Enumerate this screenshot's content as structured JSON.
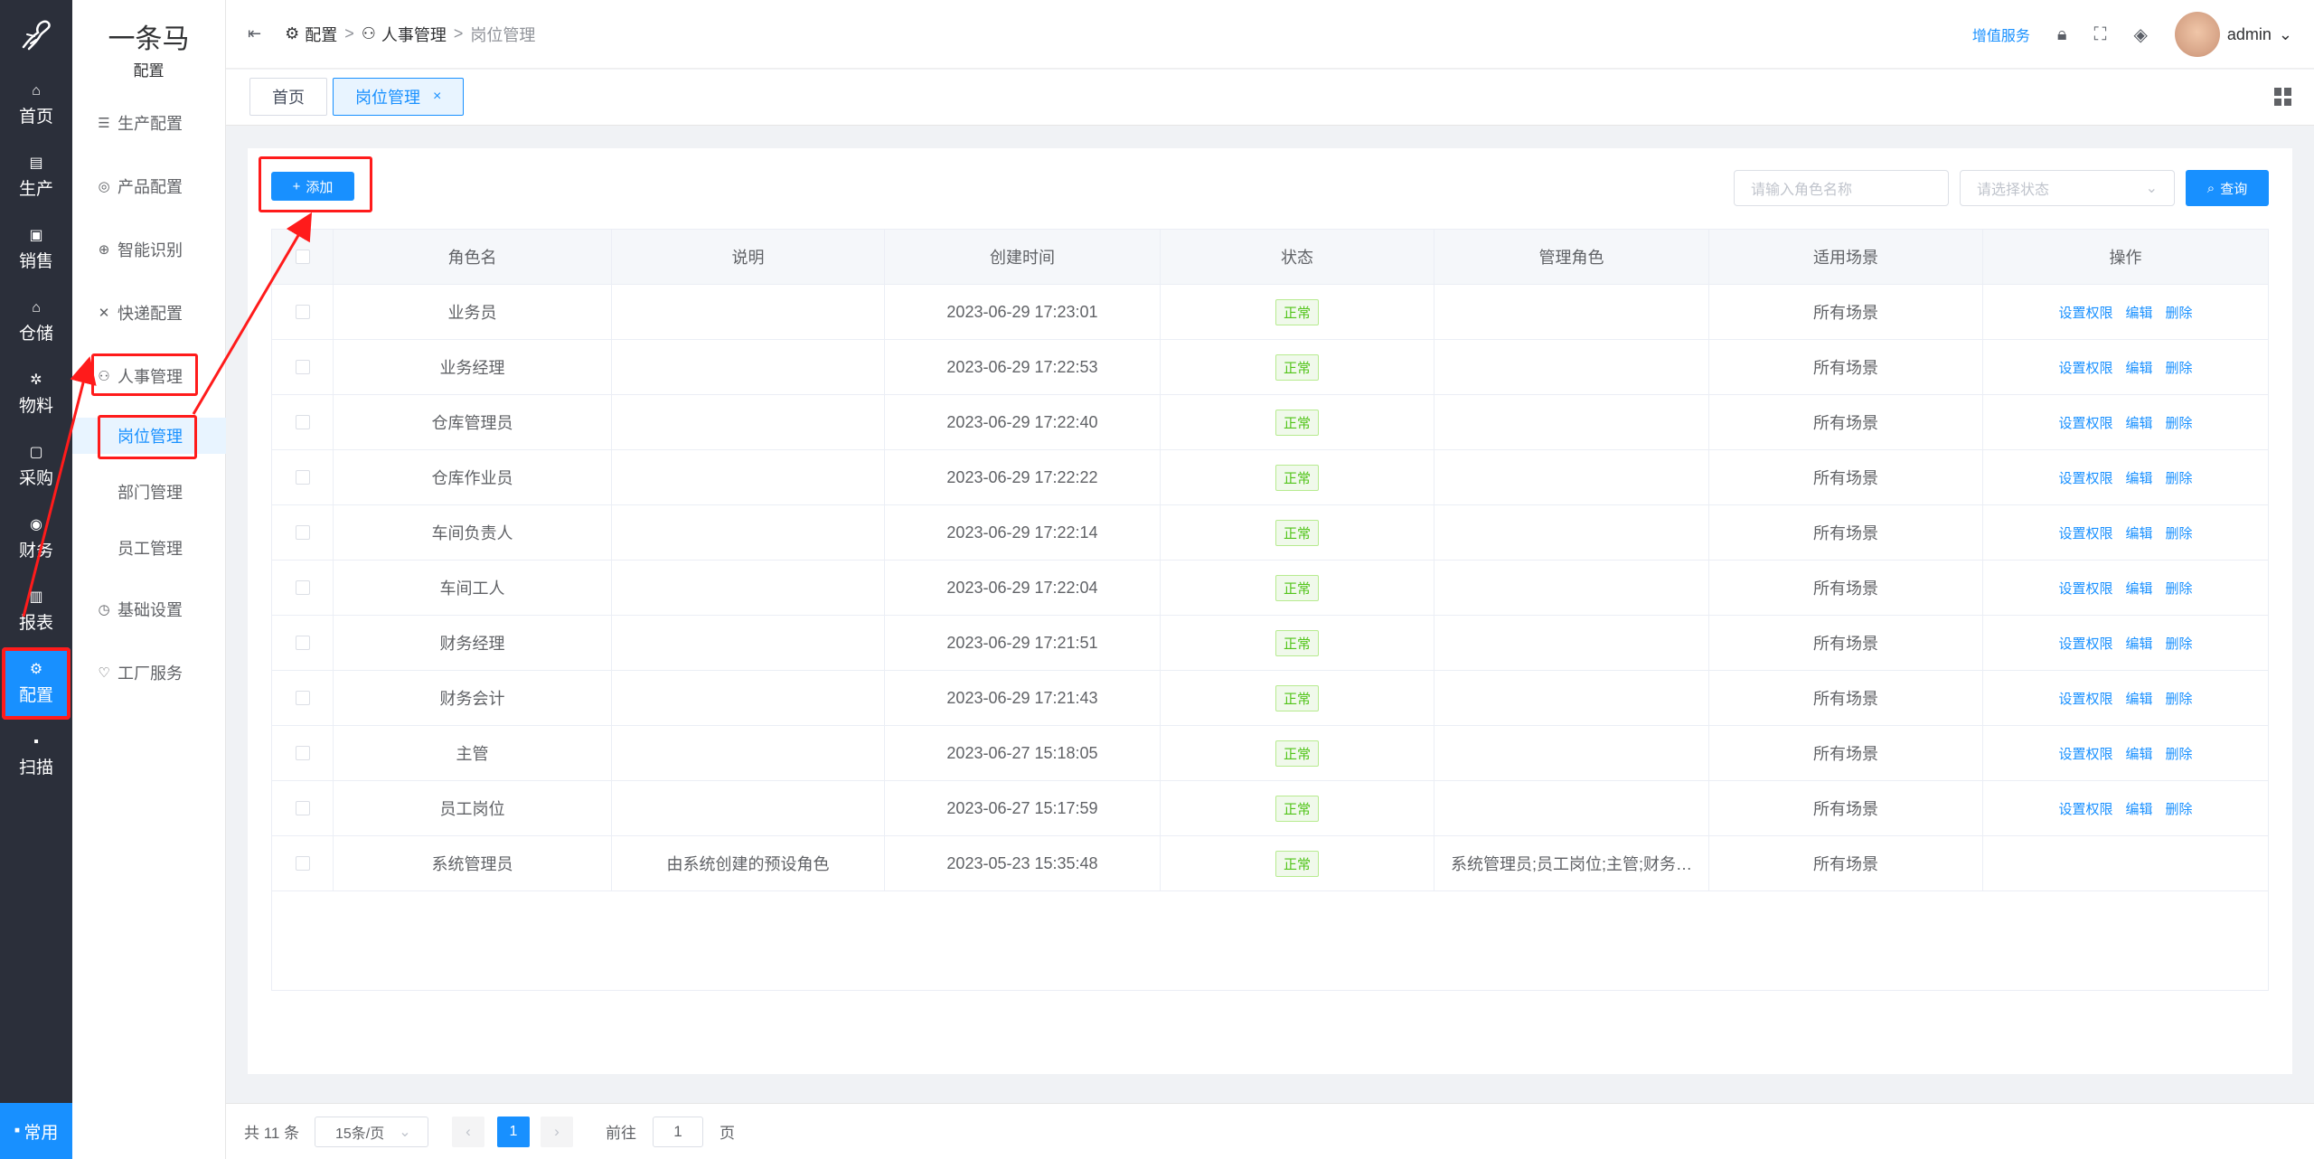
{
  "rail": {
    "items": [
      {
        "label": "首页",
        "icon": "home-icon"
      },
      {
        "label": "生产",
        "icon": "production-icon"
      },
      {
        "label": "销售",
        "icon": "sales-icon"
      },
      {
        "label": "仓储",
        "icon": "warehouse-icon"
      },
      {
        "label": "物料",
        "icon": "material-icon"
      },
      {
        "label": "采购",
        "icon": "purchase-icon"
      },
      {
        "label": "财务",
        "icon": "finance-icon"
      },
      {
        "label": "报表",
        "icon": "report-icon"
      },
      {
        "label": "配置",
        "icon": "settings-icon"
      },
      {
        "label": "扫描",
        "icon": "scan-icon"
      }
    ],
    "common_label": "常用"
  },
  "brand": {
    "name": "一条马",
    "sub": "配置"
  },
  "submenu": {
    "items": [
      {
        "label": "生产配置"
      },
      {
        "label": "产品配置"
      },
      {
        "label": "智能识别"
      },
      {
        "label": "快递配置"
      },
      {
        "label": "人事管理"
      },
      {
        "label": "基础设置"
      },
      {
        "label": "工厂服务"
      }
    ],
    "children": [
      {
        "label": "岗位管理"
      },
      {
        "label": "部门管理"
      },
      {
        "label": "员工管理"
      }
    ]
  },
  "header": {
    "breadcrumb": [
      "配置",
      "人事管理",
      "岗位管理"
    ],
    "vip_label": "增值服务",
    "user": "admin"
  },
  "tabs": [
    {
      "label": "首页"
    },
    {
      "label": "岗位管理"
    }
  ],
  "toolbar": {
    "add_label": "添加",
    "role_placeholder": "请输入角色名称",
    "status_placeholder": "请选择状态",
    "query_label": "查询"
  },
  "table": {
    "columns": [
      "角色名",
      "说明",
      "创建时间",
      "状态",
      "管理角色",
      "适用场景",
      "操作"
    ],
    "actions": [
      "设置权限",
      "编辑",
      "删除"
    ],
    "rows": [
      {
        "name": "业务员",
        "desc": "",
        "time": "2023-06-29 17:23:01",
        "status": "正常",
        "manage": "",
        "scene": "所有场景",
        "has_actions": true
      },
      {
        "name": "业务经理",
        "desc": "",
        "time": "2023-06-29 17:22:53",
        "status": "正常",
        "manage": "",
        "scene": "所有场景",
        "has_actions": true
      },
      {
        "name": "仓库管理员",
        "desc": "",
        "time": "2023-06-29 17:22:40",
        "status": "正常",
        "manage": "",
        "scene": "所有场景",
        "has_actions": true
      },
      {
        "name": "仓库作业员",
        "desc": "",
        "time": "2023-06-29 17:22:22",
        "status": "正常",
        "manage": "",
        "scene": "所有场景",
        "has_actions": true
      },
      {
        "name": "车间负责人",
        "desc": "",
        "time": "2023-06-29 17:22:14",
        "status": "正常",
        "manage": "",
        "scene": "所有场景",
        "has_actions": true
      },
      {
        "name": "车间工人",
        "desc": "",
        "time": "2023-06-29 17:22:04",
        "status": "正常",
        "manage": "",
        "scene": "所有场景",
        "has_actions": true
      },
      {
        "name": "财务经理",
        "desc": "",
        "time": "2023-06-29 17:21:51",
        "status": "正常",
        "manage": "",
        "scene": "所有场景",
        "has_actions": true
      },
      {
        "name": "财务会计",
        "desc": "",
        "time": "2023-06-29 17:21:43",
        "status": "正常",
        "manage": "",
        "scene": "所有场景",
        "has_actions": true
      },
      {
        "name": "主管",
        "desc": "",
        "time": "2023-06-27 15:18:05",
        "status": "正常",
        "manage": "",
        "scene": "所有场景",
        "has_actions": true
      },
      {
        "name": "员工岗位",
        "desc": "",
        "time": "2023-06-27 15:17:59",
        "status": "正常",
        "manage": "",
        "scene": "所有场景",
        "has_actions": true
      },
      {
        "name": "系统管理员",
        "desc": "由系统创建的预设角色",
        "time": "2023-05-23 15:35:48",
        "status": "正常",
        "manage": "系统管理员;员工岗位;主管;财务…",
        "scene": "所有场景",
        "has_actions": false
      }
    ]
  },
  "pagination": {
    "total": "共 11 条",
    "page_size": "15条/页",
    "current": "1",
    "goto_prefix": "前往",
    "goto_value": "1",
    "goto_suffix": "页"
  },
  "colors": {
    "accent": "#1890ff",
    "rail": "#2b2f3a",
    "annotation": "#ff1b1b",
    "status": "#52c41a"
  }
}
